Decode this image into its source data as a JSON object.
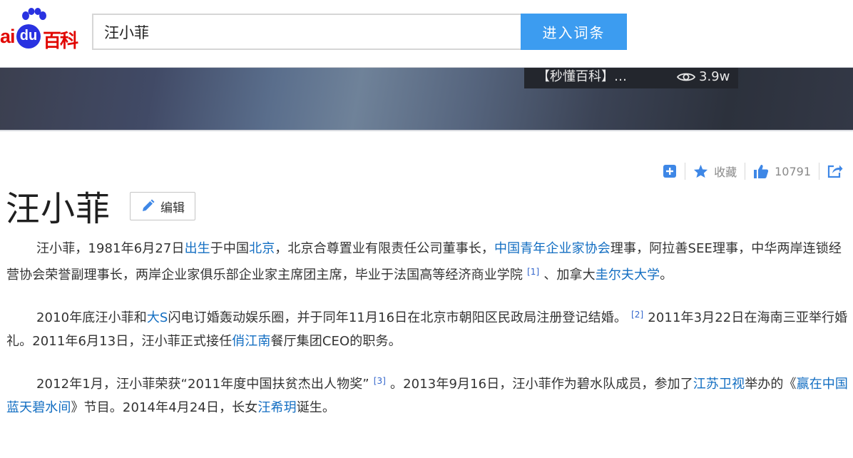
{
  "header": {
    "logo_ai": "ai",
    "logo_du": "du",
    "logo_baike": "百科",
    "search_value": "汪小菲",
    "search_button": "进入词条"
  },
  "banner": {
    "video_title": "【秒懂百科】…",
    "video_views": "3.9w"
  },
  "tools": {
    "collect_label": "收藏",
    "like_count": "10791"
  },
  "entry": {
    "title": "汪小菲",
    "edit_label": "编辑"
  },
  "paragraphs": {
    "p1": {
      "t1": "汪小菲，1981年6月27日",
      "l1": "出生",
      "t2": "于中国",
      "l2": "北京",
      "t3": "，北京合尊置业有限责任公司董事长，",
      "l3": "中国青年企业家协会",
      "t4": "理事，阿拉善SEE理事，中华两岸连锁经营协会荣誉副理事长，两岸企业家俱乐部企业家主席团主席，毕业于法国高等经济商业学院",
      "r1": "[1]",
      "t5": "、加拿大",
      "l4": "圭尔夫大学",
      "t6": "。"
    },
    "p2": {
      "t1": "2010年底汪小菲和",
      "l1": "大S",
      "t2": "闪电订婚轰动娱乐圈，并于同年11月16日在北京市朝阳区民政局注册登记结婚。",
      "r1": "[2]",
      "t3": "2011年3月22日在海南三亚举行婚礼。2011年6月13日，汪小菲正式接任",
      "l2": "俏江南",
      "t4": "餐厅集团CEO的职务。"
    },
    "p3": {
      "t1": "2012年1月，汪小菲荣获“2011年度中国扶贫杰出人物奖”",
      "r1": "[3]",
      "t2": "。2013年9月16日，汪小菲作为碧水队成员，参加了",
      "l1": "江苏卫视",
      "t3": "举办的《",
      "l2": "赢在中国蓝天碧水间",
      "t4": "》节目。2014年4月24日，长女",
      "l3": "汪希玥",
      "t5": "诞生。"
    }
  },
  "colors": {
    "brand_red": "#e10601",
    "brand_blue": "#2932e1",
    "search_button": "#3c9cf0",
    "link": "#136ec2",
    "tool_icon": "#3e87e6"
  },
  "icons": [
    "paw-icon",
    "eye-icon",
    "add-icon",
    "star-icon",
    "thumb-up-icon",
    "share-icon",
    "pencil-icon"
  ]
}
